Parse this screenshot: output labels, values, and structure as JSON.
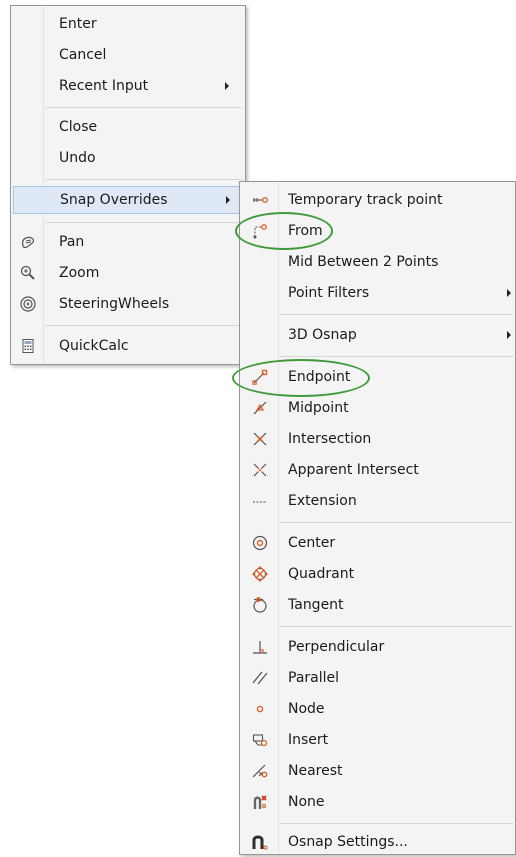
{
  "colors": {
    "menu_bg": "#f4f4f4",
    "highlight": "#dfe9f5",
    "annotation": "#3e9a3a",
    "snap_icon": "#e0602a"
  },
  "main_menu": {
    "items": [
      {
        "label": "Enter"
      },
      {
        "label": "Cancel"
      },
      {
        "label": "Recent Input",
        "submenu": true
      },
      {
        "label": "Close"
      },
      {
        "label": "Undo"
      },
      {
        "label": "Snap Overrides",
        "submenu": true,
        "highlighted": true
      },
      {
        "label": "Pan",
        "icon": "pan-icon"
      },
      {
        "label": "Zoom",
        "icon": "zoom-icon"
      },
      {
        "label": "SteeringWheels",
        "icon": "steering-wheels-icon"
      },
      {
        "label": "QuickCalc",
        "icon": "calculator-icon"
      }
    ]
  },
  "snap_menu": {
    "items": [
      {
        "label": "Temporary track point",
        "icon": "temporary-track-point-icon"
      },
      {
        "label": "From",
        "icon": "from-icon",
        "annotated": true
      },
      {
        "label": "Mid Between 2 Points"
      },
      {
        "label": "Point Filters",
        "submenu": true
      },
      {
        "label": "3D Osnap",
        "submenu": true
      },
      {
        "label": "Endpoint",
        "icon": "endpoint-icon",
        "annotated": true
      },
      {
        "label": "Midpoint",
        "icon": "midpoint-icon"
      },
      {
        "label": "Intersection",
        "icon": "intersection-icon"
      },
      {
        "label": "Apparent Intersect",
        "icon": "apparent-intersect-icon"
      },
      {
        "label": "Extension",
        "icon": "extension-icon"
      },
      {
        "label": "Center",
        "icon": "center-icon"
      },
      {
        "label": "Quadrant",
        "icon": "quadrant-icon"
      },
      {
        "label": "Tangent",
        "icon": "tangent-icon"
      },
      {
        "label": "Perpendicular",
        "icon": "perpendicular-icon"
      },
      {
        "label": "Parallel",
        "icon": "parallel-icon"
      },
      {
        "label": "Node",
        "icon": "node-icon"
      },
      {
        "label": "Insert",
        "icon": "insert-icon"
      },
      {
        "label": "Nearest",
        "icon": "nearest-icon"
      },
      {
        "label": "None",
        "icon": "none-icon"
      },
      {
        "label": "Osnap Settings...",
        "icon": "osnap-settings-icon"
      }
    ]
  }
}
